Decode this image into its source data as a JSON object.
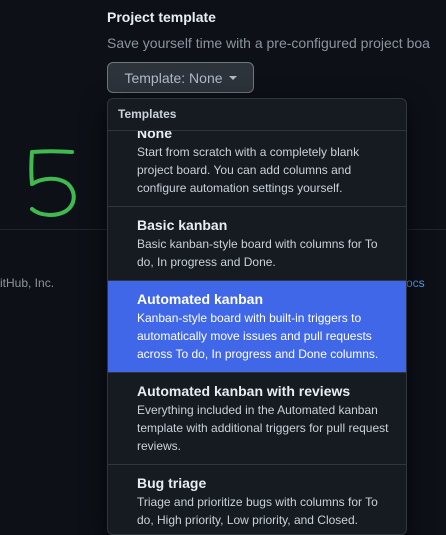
{
  "section": {
    "title": "Project template",
    "description": "Save yourself time with a pre-configured project boa",
    "button_label": "Template: None"
  },
  "background": {
    "footer_left": "itHub, Inc.",
    "footer_right": "ocs"
  },
  "dropdown": {
    "header": "Templates",
    "items": [
      {
        "title": "None",
        "description": "Start from scratch with a completely blank project board. You can add columns and configure automation settings yourself.",
        "selected": false
      },
      {
        "title": "Basic kanban",
        "description": "Basic kanban-style board with columns for To do, In progress and Done.",
        "selected": false
      },
      {
        "title": "Automated kanban",
        "description": "Kanban-style board with built-in triggers to automatically move issues and pull requests across To do, In progress and Done columns.",
        "selected": true
      },
      {
        "title": "Automated kanban with reviews",
        "description": "Everything included in the Automated kanban template with additional triggers for pull request reviews.",
        "selected": false
      },
      {
        "title": "Bug triage",
        "description": "Triage and prioritize bugs with columns for To do, High priority, Low priority, and Closed.",
        "selected": false
      }
    ]
  },
  "colors": {
    "background": "#0d1117",
    "selected": "#4067e8",
    "annotation": "#3fb950"
  },
  "annotation": {
    "handwritten_number": "5"
  }
}
